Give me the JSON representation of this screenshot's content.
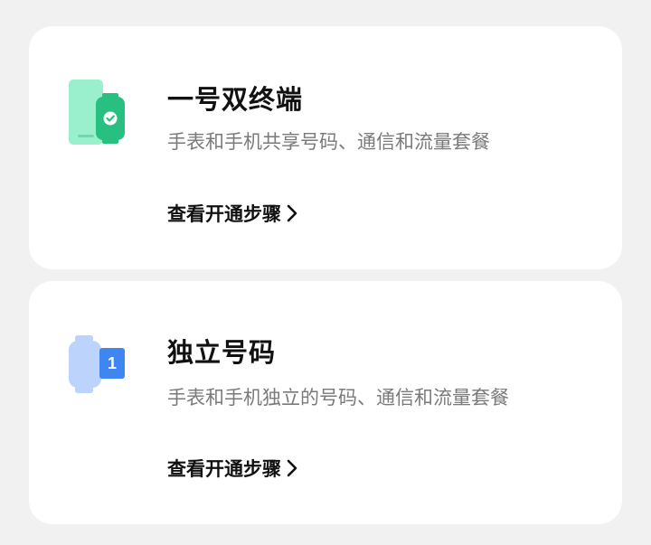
{
  "cards": [
    {
      "title": "一号双终端",
      "subtitle": "手表和手机共享号码、通信和流量套餐",
      "link_label": "查看开通步骤",
      "icon": "phone-watch-sync-icon",
      "accent": "#2fc48a"
    },
    {
      "title": "独立号码",
      "subtitle": "手表和手机独立的号码、通信和流量套餐",
      "link_label": "查看开通步骤",
      "icon": "watch-number-one-icon",
      "accent": "#3f86f0",
      "badge": "1"
    }
  ]
}
